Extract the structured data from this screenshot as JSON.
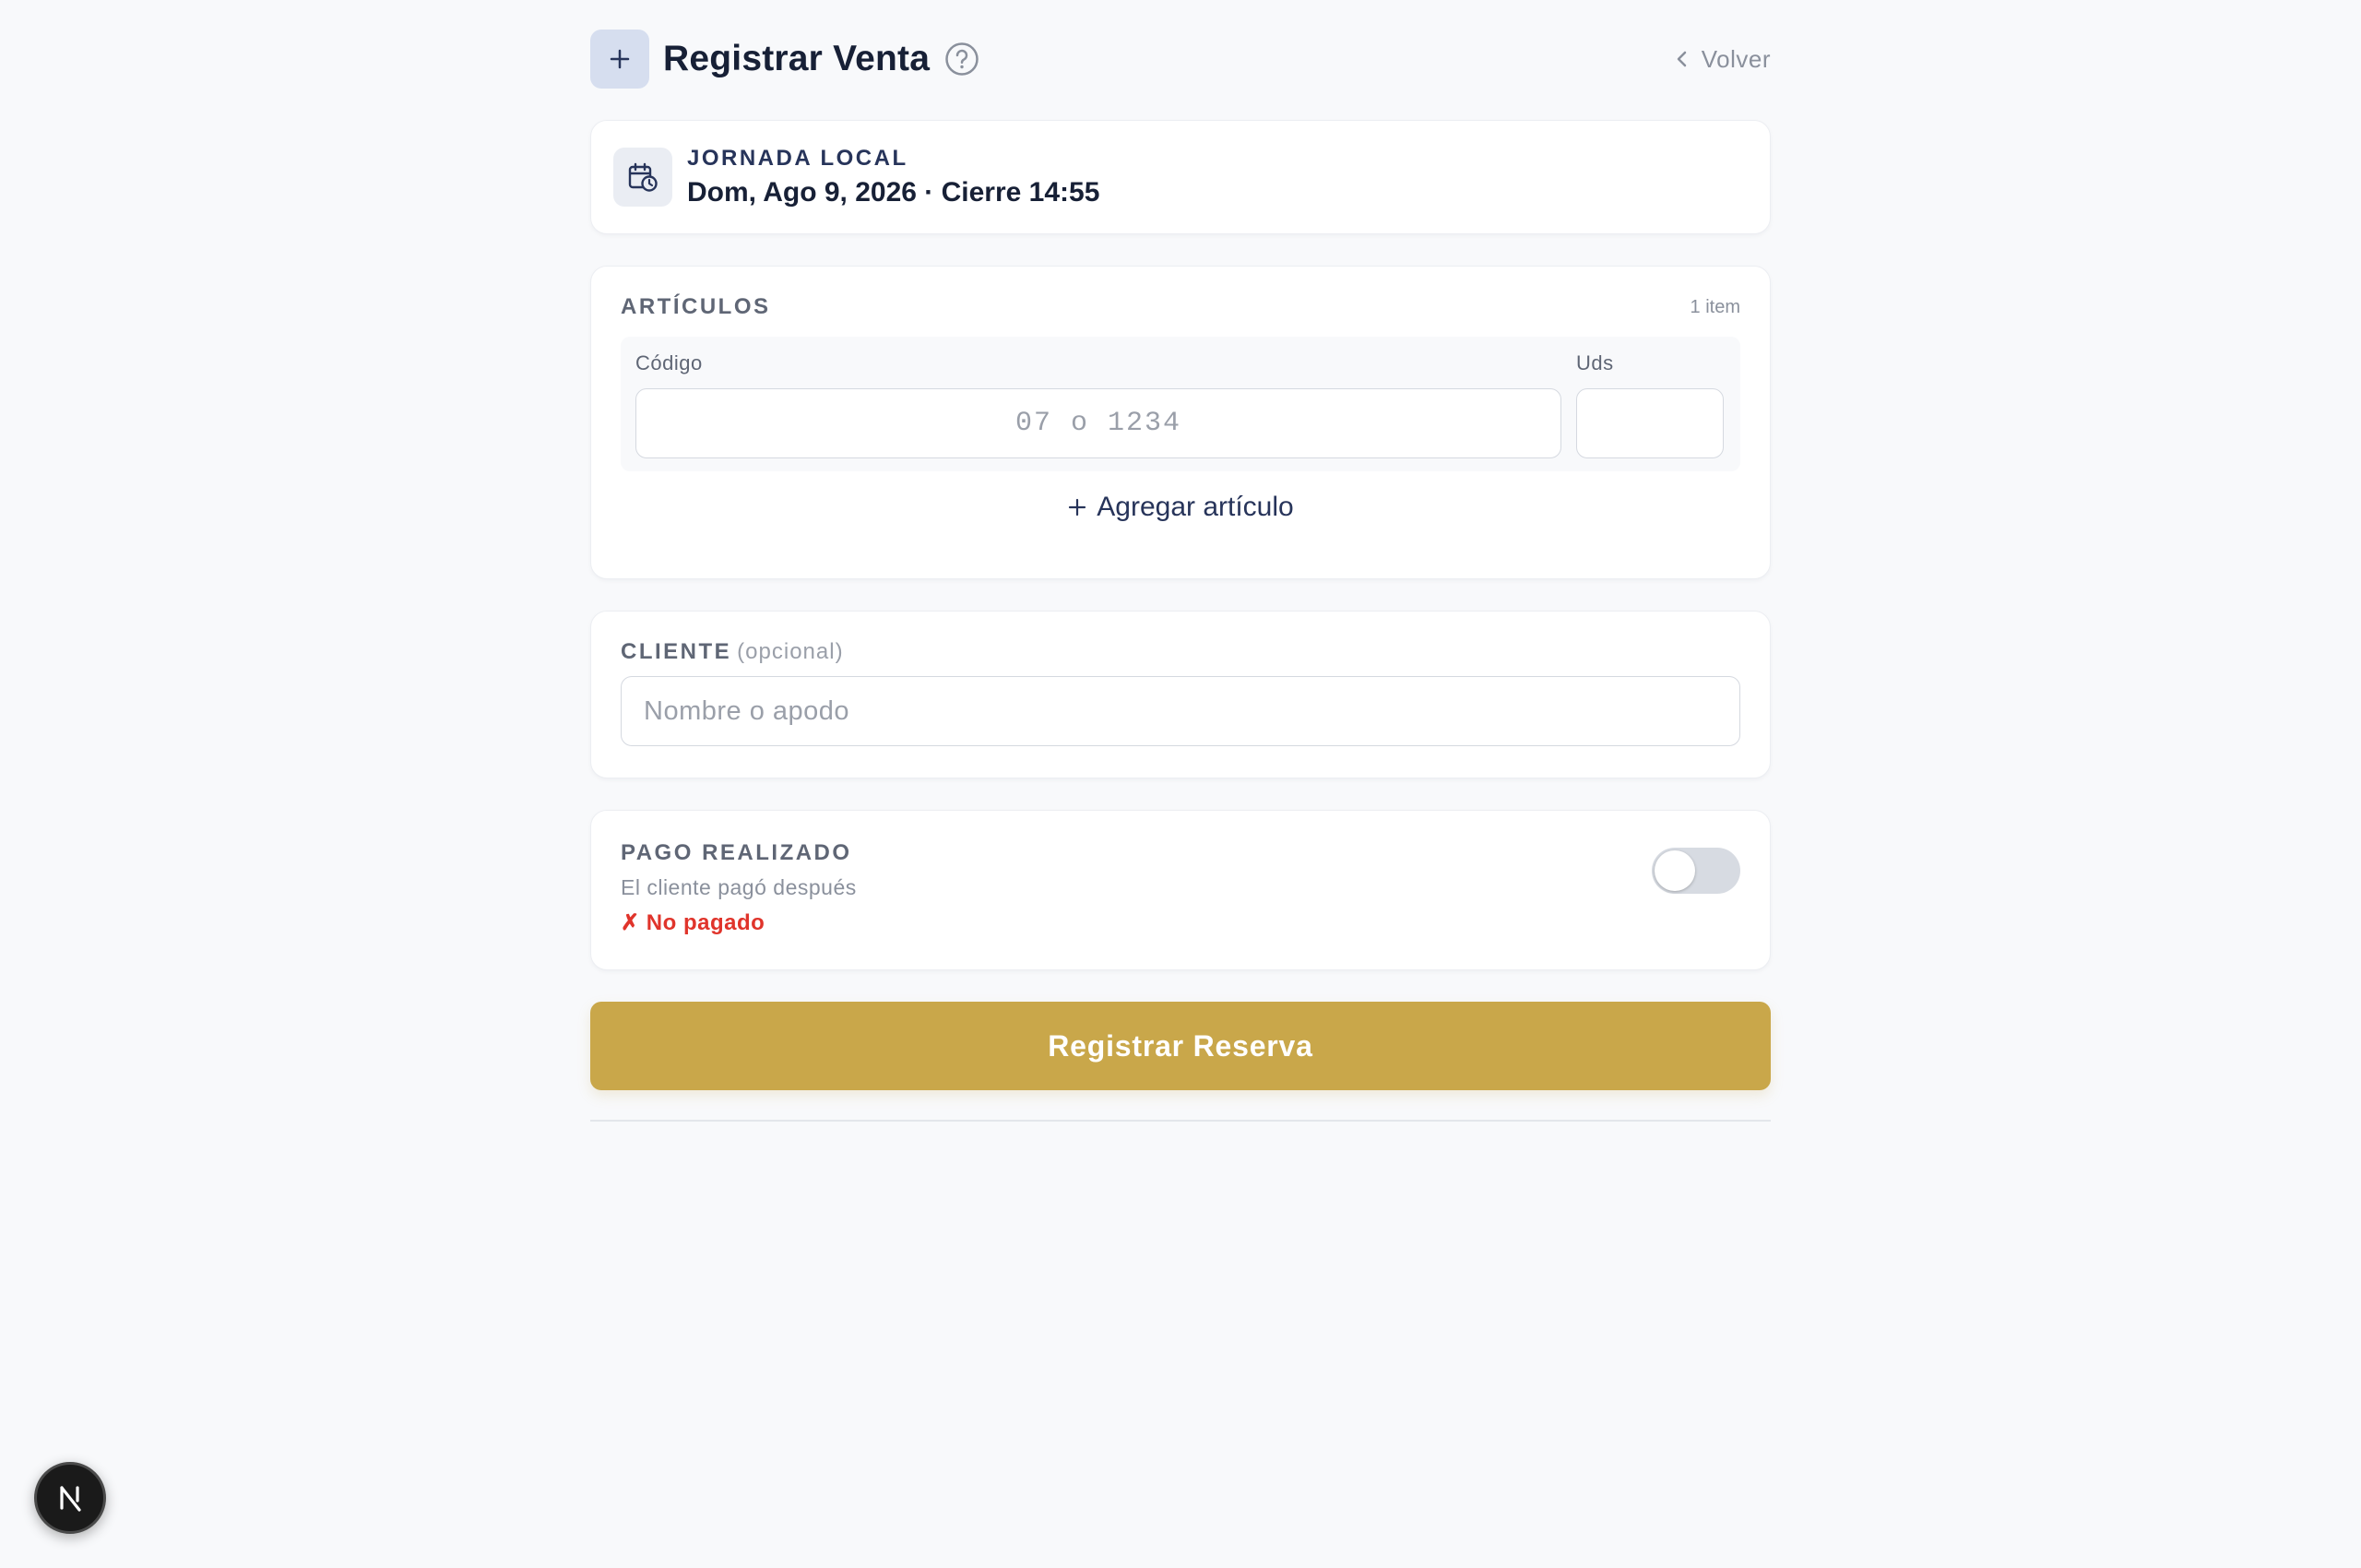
{
  "header": {
    "title": "Registrar Venta",
    "back_label": "Volver"
  },
  "jornada": {
    "label": "JORNADA LOCAL",
    "date": "Dom, Ago 9, 2026 · Cierre 14:55"
  },
  "articles": {
    "section_label": "ARTÍCULOS",
    "count_label": "1 item",
    "code_label": "Código",
    "code_placeholder": "07 o 1234",
    "code_value": "",
    "uds_label": "Uds",
    "uds_value": "",
    "add_label": "Agregar artículo"
  },
  "client": {
    "section_label": "CLIENTE",
    "optional_label": "(opcional)",
    "placeholder": "Nombre o apodo",
    "value": ""
  },
  "payment": {
    "section_label": "PAGO REALIZADO",
    "subtitle": "El cliente pagó después",
    "status": "✗ No pagado",
    "toggle_on": false
  },
  "submit": {
    "label": "Registrar Reserva"
  },
  "colors": {
    "accent_gold": "#c9a74a",
    "status_red": "#e0342b",
    "navy": "#172036"
  },
  "icons": {
    "header_badge": "plus-icon",
    "help": "question-circle-icon",
    "back": "chevron-left-icon",
    "jornada": "calendar-clock-icon",
    "add": "plus-icon",
    "fab": "nextjs-logo-icon"
  }
}
